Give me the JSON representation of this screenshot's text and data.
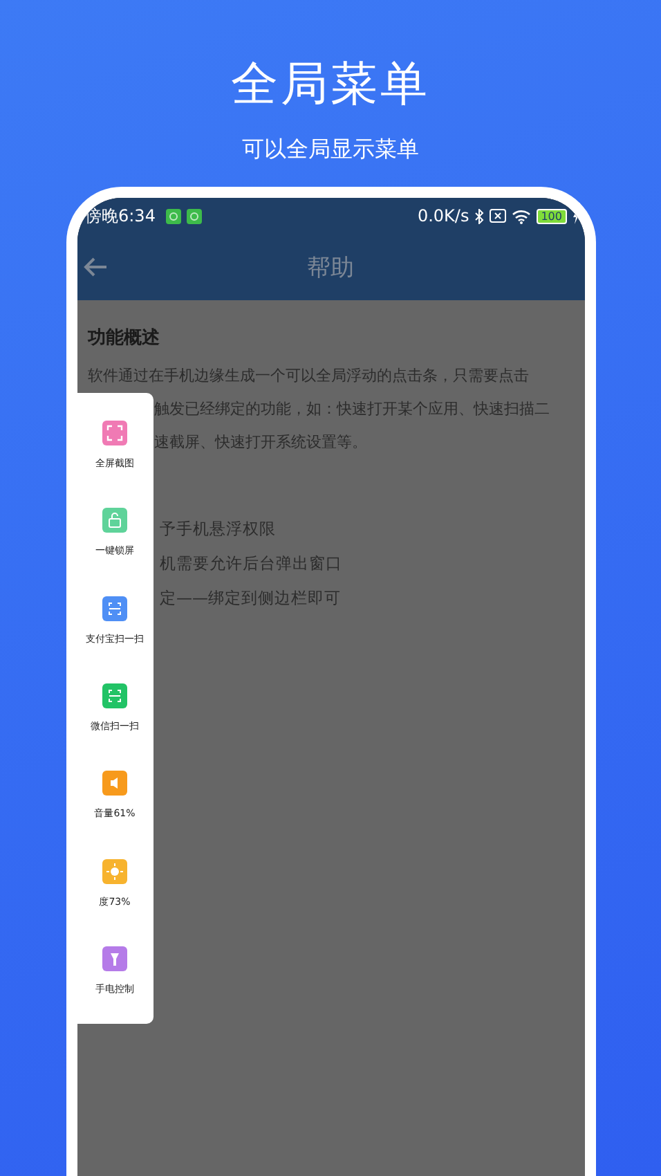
{
  "promo": {
    "title": "全局菜单",
    "subtitle": "可以全局显示菜单"
  },
  "status_bar": {
    "time": "傍晚6:34",
    "speed": "0.0K/s",
    "battery": "100"
  },
  "app_bar": {
    "title": "帮助"
  },
  "content": {
    "heading": "功能概述",
    "paragraph_first": "软件通过在手机边缘生成一个可以全局浮动的点击条，只需要点击",
    "paragraph_rest": [
      "触发已经绑定的功能，如：快速打开某个应用、快速扫描二",
      "速截屏、快速打开系统设置等。"
    ],
    "steps": [
      "予手机悬浮权限",
      "机需要允许后台弹出窗口",
      "定——绑定到侧边栏即可"
    ]
  },
  "menu": [
    {
      "label": "全屏截图",
      "kind": "screenshot",
      "color": "#f07ab4"
    },
    {
      "label": "一键锁屏",
      "kind": "lock",
      "color": "#5fd39a"
    },
    {
      "label": "支付宝扫一扫",
      "kind": "scan",
      "color": "#4f8ff5"
    },
    {
      "label": "微信扫一扫",
      "kind": "scan",
      "color": "#22c366"
    },
    {
      "label": "音量61%",
      "kind": "volume",
      "color": "#f79a1c"
    },
    {
      "label": "度73%",
      "kind": "brightness",
      "color": "#f7b32e"
    },
    {
      "label": "手电控制",
      "kind": "torch",
      "color": "#b57be8"
    }
  ]
}
